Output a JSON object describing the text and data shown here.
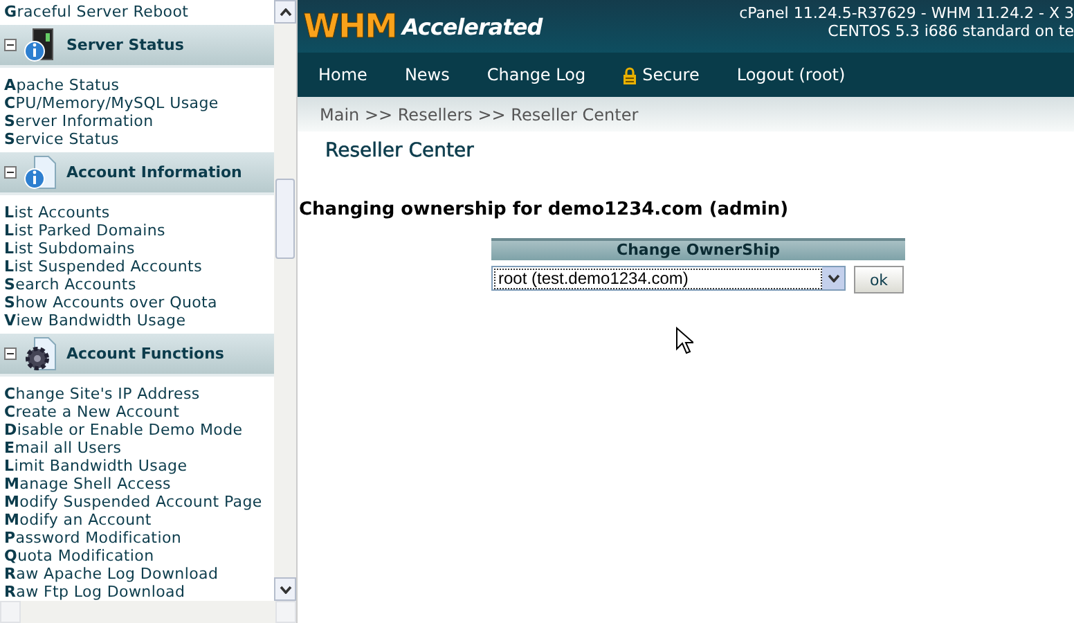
{
  "sidebar": {
    "top_item": "Graceful Server Reboot",
    "sections": [
      {
        "title": "Server Status",
        "kind": "server",
        "expanded": true,
        "items": [
          "Apache Status",
          "CPU/Memory/MySQL Usage",
          "Server Information",
          "Service Status"
        ]
      },
      {
        "title": "Account Information",
        "kind": "document",
        "expanded": true,
        "items": [
          "List Accounts",
          "List Parked Domains",
          "List Subdomains",
          "List Suspended Accounts",
          "Search Accounts",
          "Show Accounts over Quota",
          "View Bandwidth Usage"
        ]
      },
      {
        "title": "Account Functions",
        "kind": "gear",
        "expanded": true,
        "items": [
          "Change Site's IP Address",
          "Create a New Account",
          "Disable or Enable Demo Mode",
          "Email all Users",
          "Limit Bandwidth Usage",
          "Manage Shell Access",
          "Modify Suspended Account Page",
          "Modify an Account",
          "Password Modification",
          "Quota Modification",
          "Raw Apache Log Download",
          "Raw Ftp Log Download"
        ]
      }
    ]
  },
  "header": {
    "logo_main": "WHM",
    "logo_sub": "Accelerated",
    "version_lines": [
      "cPanel 11.24.5-R37629 - WHM 11.24.2 - X 3",
      "CENTOS 5.3 i686 standard on te"
    ]
  },
  "nav": [
    {
      "label": "Home",
      "kind": "plain"
    },
    {
      "label": "News",
      "kind": "plain"
    },
    {
      "label": "Change Log",
      "kind": "plain"
    },
    {
      "label": "Secure",
      "kind": "lock"
    },
    {
      "label": "Logout (root)",
      "kind": "plain"
    }
  ],
  "breadcrumb": "Main >> Resellers >> Reseller Center",
  "page_title": "Reseller Center",
  "heading": "Changing ownership for demo1234.com (admin)",
  "form": {
    "title": "Change OwnerShip",
    "select_value": "root (test.demo1234.com)",
    "button": "ok"
  }
}
